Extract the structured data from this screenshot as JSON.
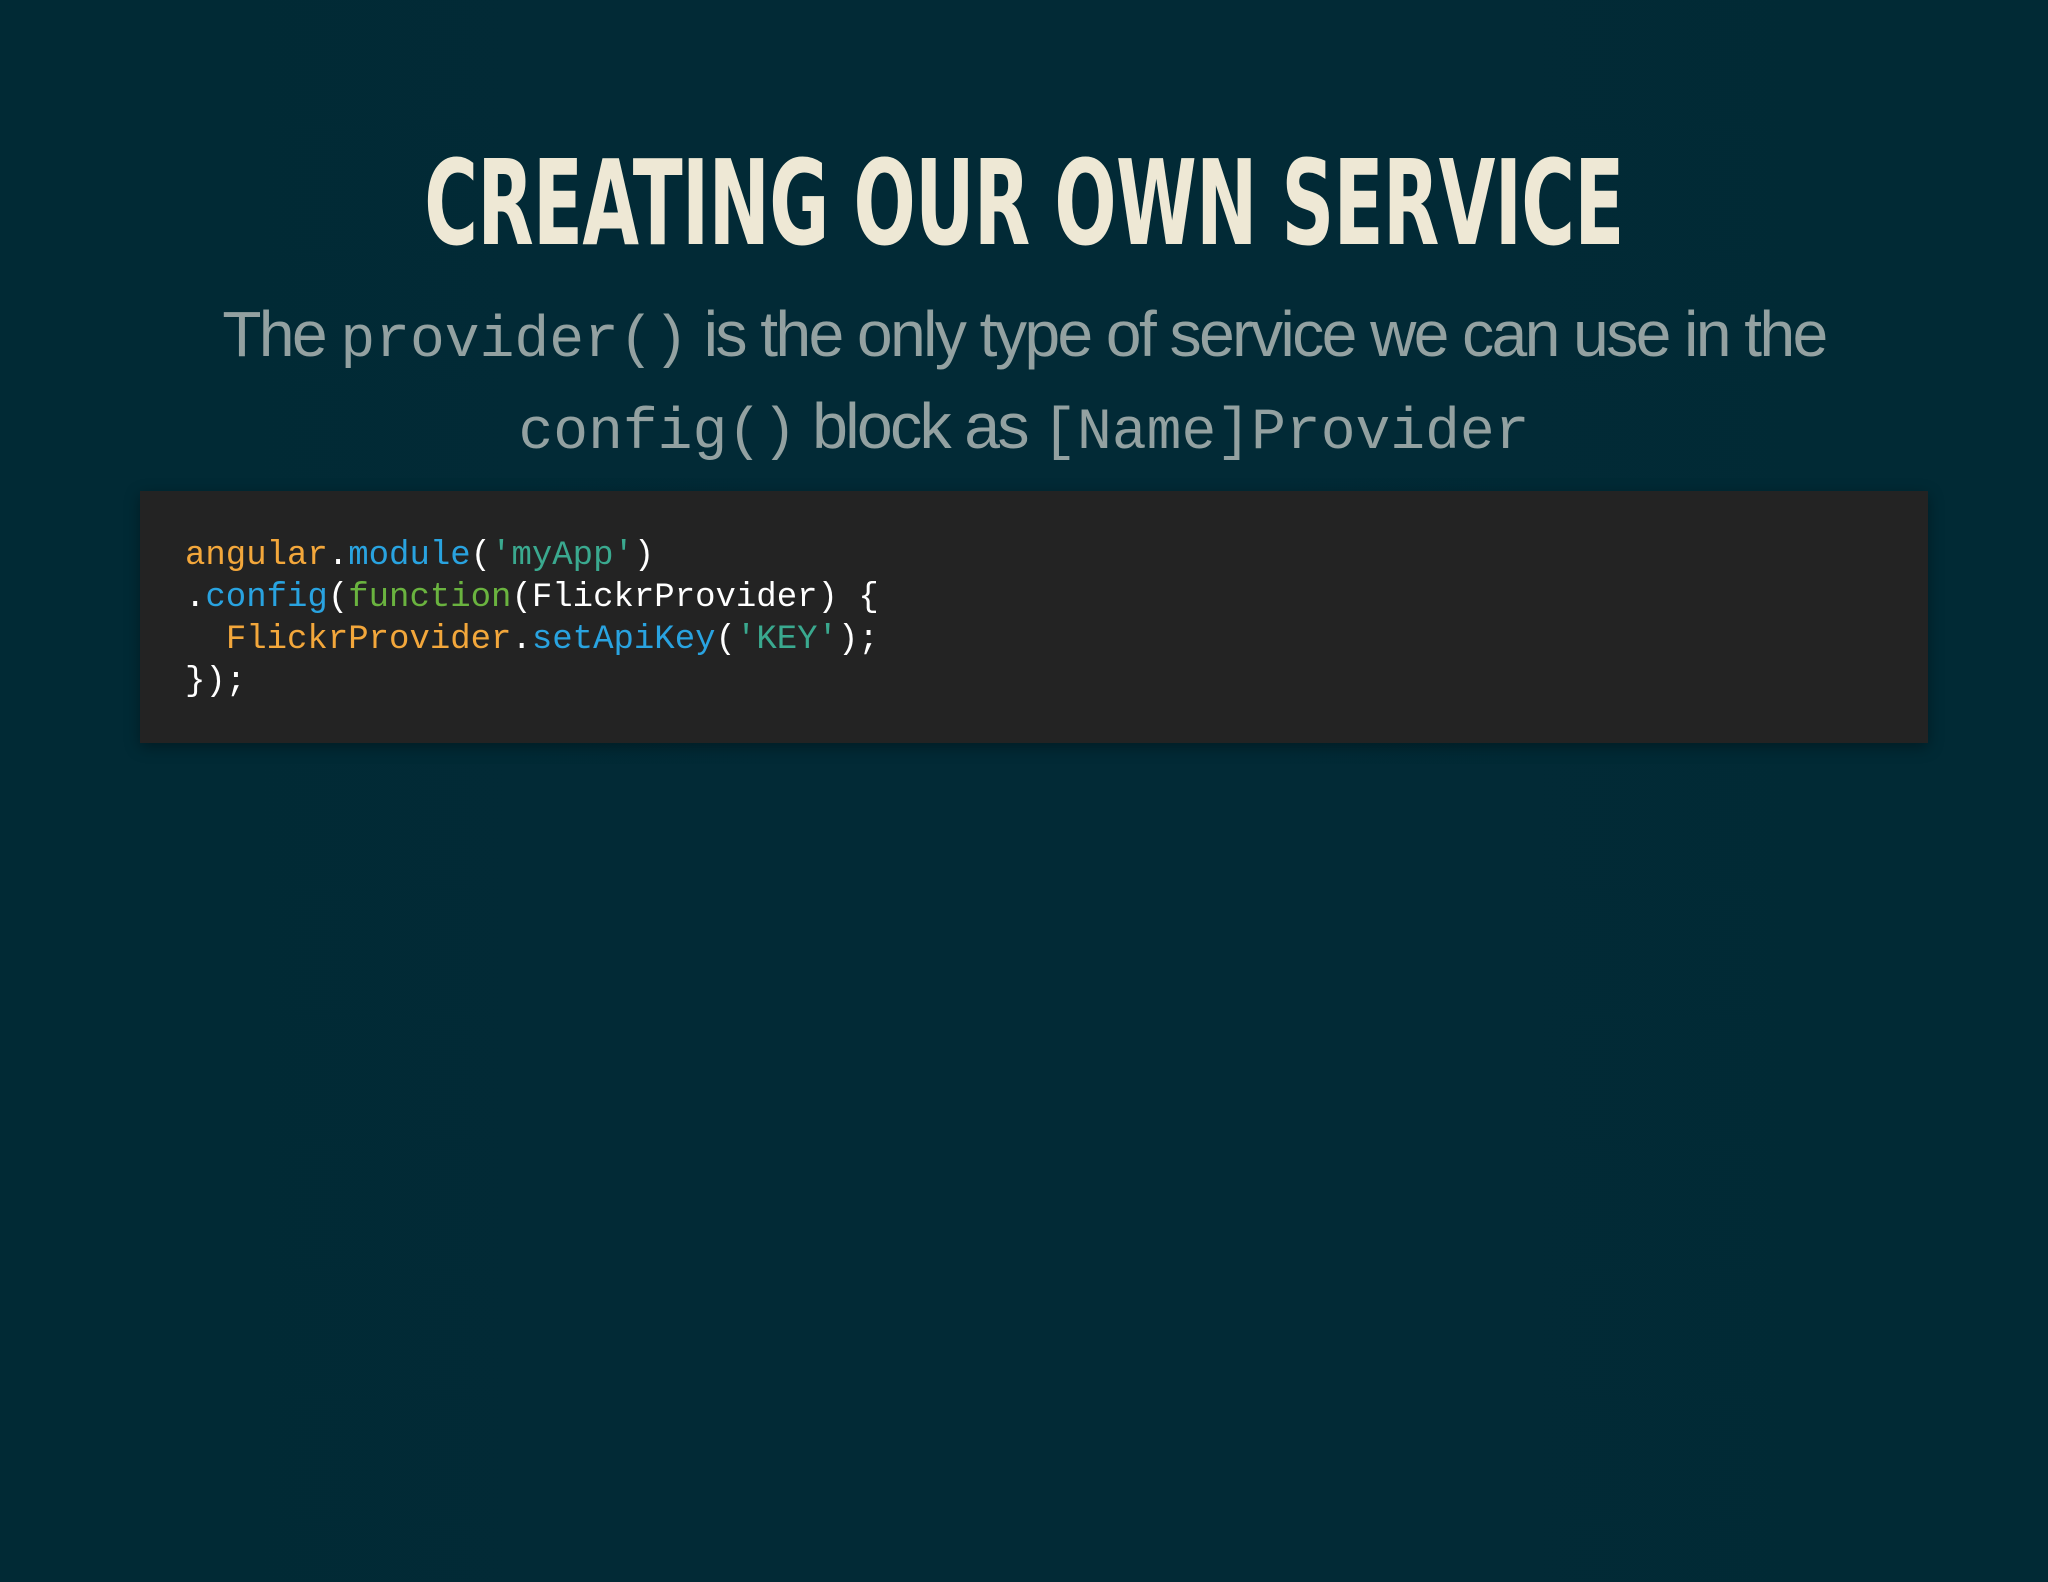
{
  "slide": {
    "title": "CREATING OUR OWN SERVICE",
    "subtitle": {
      "part1": "The ",
      "code1": "provider()",
      "part2": " is the only type of service we can use in the ",
      "code2": "config()",
      "part3": " block as ",
      "code3": "[Name]Provider"
    },
    "code_lines": [
      [
        {
          "text": "angular",
          "kind": "var"
        },
        {
          "text": ".",
          "kind": "plain"
        },
        {
          "text": "module",
          "kind": "fn"
        },
        {
          "text": "(",
          "kind": "plain"
        },
        {
          "text": "'myApp'",
          "kind": "str"
        },
        {
          "text": ")",
          "kind": "plain"
        }
      ],
      [
        {
          "text": ".",
          "kind": "plain"
        },
        {
          "text": "config",
          "kind": "fn"
        },
        {
          "text": "(",
          "kind": "plain"
        },
        {
          "text": "function",
          "kind": "kw"
        },
        {
          "text": "(FlickrProvider) {",
          "kind": "plain"
        }
      ],
      [
        {
          "text": "  ",
          "kind": "plain"
        },
        {
          "text": "FlickrProvider",
          "kind": "var"
        },
        {
          "text": ".",
          "kind": "plain"
        },
        {
          "text": "setApiKey",
          "kind": "fn"
        },
        {
          "text": "(",
          "kind": "plain"
        },
        {
          "text": "'KEY'",
          "kind": "str"
        },
        {
          "text": ");",
          "kind": "plain"
        }
      ],
      [
        {
          "text": "});",
          "kind": "plain"
        }
      ]
    ]
  },
  "colors": {
    "background": "#002b36",
    "title": "#eee8d5",
    "subtitle": "#93a1a1",
    "code_background": "#232323",
    "code_variable": "#f3a73b",
    "code_function": "#29a3e0",
    "code_string": "#3aa98f",
    "code_keyword": "#6ab33f",
    "code_plain": "#ffffff"
  }
}
